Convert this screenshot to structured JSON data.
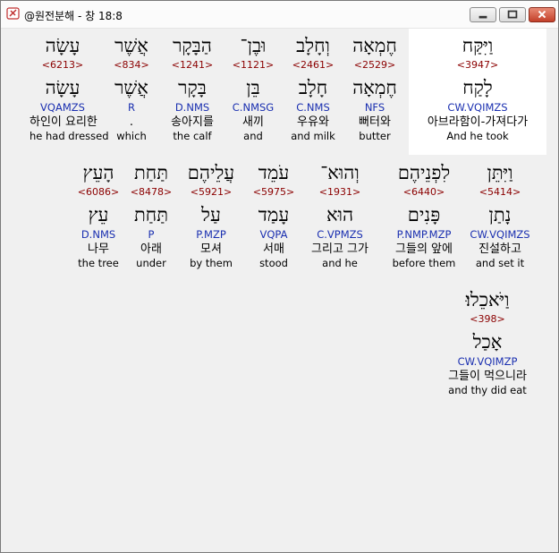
{
  "window": {
    "title": "@원전분해 - 창 18:8"
  },
  "rows": [
    [
      {
        "heb": "עָשָׂה",
        "num": "<6213>",
        "lemma": "עָשָׂה",
        "morph": "VQAMZS",
        "kor": "하인이 요리한",
        "eng": "he had dressed"
      },
      {
        "heb": "אֲשֶׁר",
        "num": "<834>",
        "lemma": "אֲשֶׁר",
        "morph": "R",
        "kor": ".",
        "eng": "which"
      },
      {
        "heb": "הַבָּקָר",
        "num": "<1241>",
        "lemma": "בָּקָר",
        "morph": "D.NMS",
        "kor": "송아지를",
        "eng": "the calf"
      },
      {
        "heb": "וּבֶן־",
        "num": "<1121>",
        "lemma": "בֵּן",
        "morph": "C.NMSG",
        "kor": "새끼",
        "eng": "and"
      },
      {
        "heb": "וְחָלָב",
        "num": "<2461>",
        "lemma": "חָלָב",
        "morph": "C.NMS",
        "kor": "우유와",
        "eng": "and milk"
      },
      {
        "heb": "חֶמְאָה",
        "num": "<2529>",
        "lemma": "חֶמְאָה",
        "morph": "NFS",
        "kor": "뻐터와",
        "eng": "butter"
      },
      {
        "heb": "וַיִּקַּח",
        "num": "<3947>",
        "lemma": "לָקַח",
        "morph": "CW.VQIMZS",
        "kor": "아브라함이-가져다가",
        "eng": "And he took"
      }
    ],
    [
      {
        "heb": "הָעֵץ",
        "num": "<6086>",
        "lemma": "עֵץ",
        "morph": "D.NMS",
        "kor": "나무",
        "eng": "the tree"
      },
      {
        "heb": "תַּחַת",
        "num": "<8478>",
        "lemma": "תַּחַת",
        "morph": "P",
        "kor": "아래",
        "eng": "under"
      },
      {
        "heb": "עֲלֵיהֶם",
        "num": "<5921>",
        "lemma": "עַל",
        "morph": "P.MZP",
        "kor": "모셔",
        "eng": "by them"
      },
      {
        "heb": "עֹמֵד",
        "num": "<5975>",
        "lemma": "עָמַד",
        "morph": "VQPA",
        "kor": "서매",
        "eng": "stood"
      },
      {
        "heb": "וְהוּא־",
        "num": "<1931>",
        "lemma": "הוּא",
        "morph": "C.VPMZS",
        "kor": "그리고 그가",
        "eng": "and he"
      },
      {
        "heb": "לִפְנֵיהֶם",
        "num": "<6440>",
        "lemma": "פָּנִים",
        "morph": "P.NMP.MZP",
        "kor": "그들의 앞에",
        "eng": "before them"
      },
      {
        "heb": "וַיִּתֵּן",
        "num": "<5414>",
        "lemma": "נָתַן",
        "morph": "CW.VQIMZS",
        "kor": "진설하고",
        "eng": "and set it"
      }
    ],
    [
      {
        "heb": "וַיֹּאכֵלוּ׃",
        "num": "<398>",
        "lemma": "אָכַל",
        "morph": "CW.VQIMZP",
        "kor": "그들이 먹으니라",
        "eng": "and thy did eat"
      }
    ]
  ]
}
